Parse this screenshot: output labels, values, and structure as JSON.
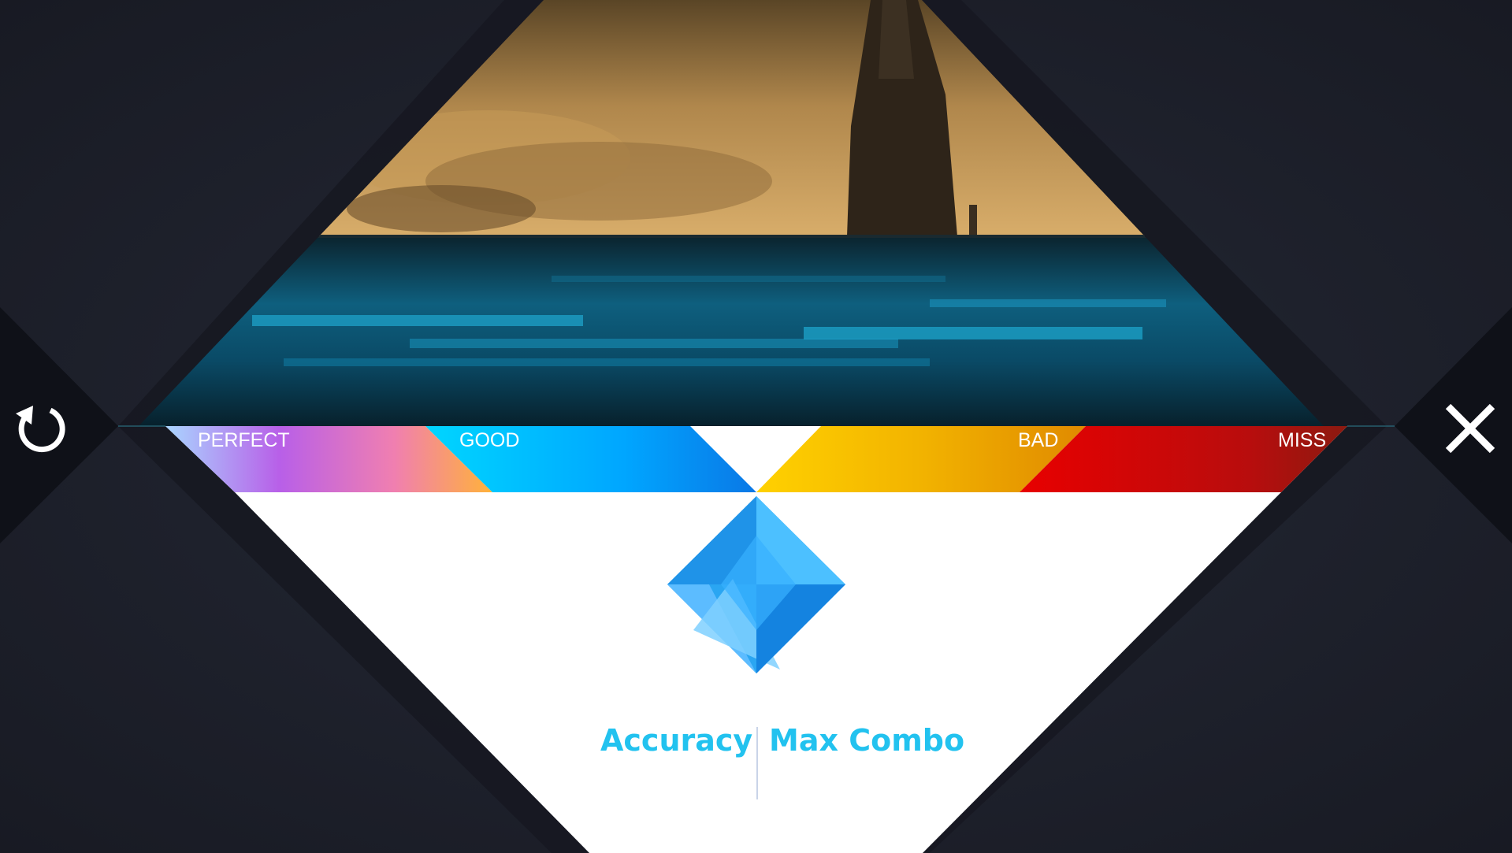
{
  "judgments": {
    "perfect_label": "PERFECT",
    "good_label": "GOOD",
    "bad_label": "BAD",
    "miss_label": "MISS"
  },
  "stats": {
    "accuracy_label": "Accuracy",
    "max_combo_label": "Max Combo"
  },
  "controls": {
    "retry_icon": "retry-icon",
    "close_icon": "close-icon"
  },
  "colors": {
    "accent": "#22c2ef",
    "perfect": "#b35be6",
    "good": "#00c6ff",
    "bad": "#f5b000",
    "miss": "#d40000"
  }
}
